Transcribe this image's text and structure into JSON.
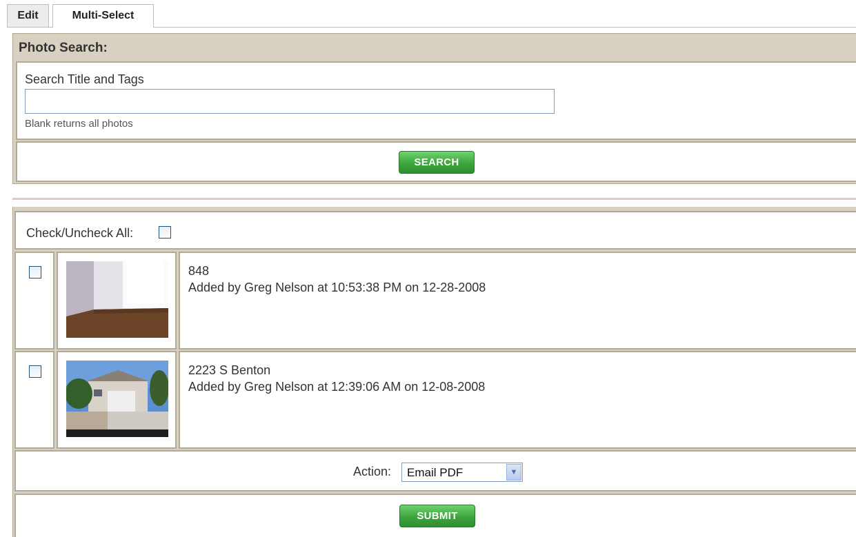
{
  "tabs": {
    "edit": "Edit",
    "multi_select": "Multi-Select"
  },
  "search": {
    "heading": "Photo Search:",
    "label": "Search Title and Tags",
    "value": "",
    "hint": "Blank returns all photos",
    "button": "SEARCH"
  },
  "results": {
    "check_all_label": "Check/Uncheck All:",
    "rows": [
      {
        "title": "848",
        "meta": "Added by Greg Nelson at 10:53:38 PM on 12-28-2008"
      },
      {
        "title": "2223 S Benton",
        "meta": "Added by Greg Nelson at 12:39:06 AM on 12-08-2008"
      }
    ],
    "action_label": "Action:",
    "action_value": "Email PDF",
    "submit": "SUBMIT"
  },
  "colors": {
    "panel_bg": "#d8d0c0",
    "button_green": "#3da53d",
    "input_border": "#7f9db9"
  },
  "icons": {
    "select_arrow": "chevron-down-icon"
  }
}
